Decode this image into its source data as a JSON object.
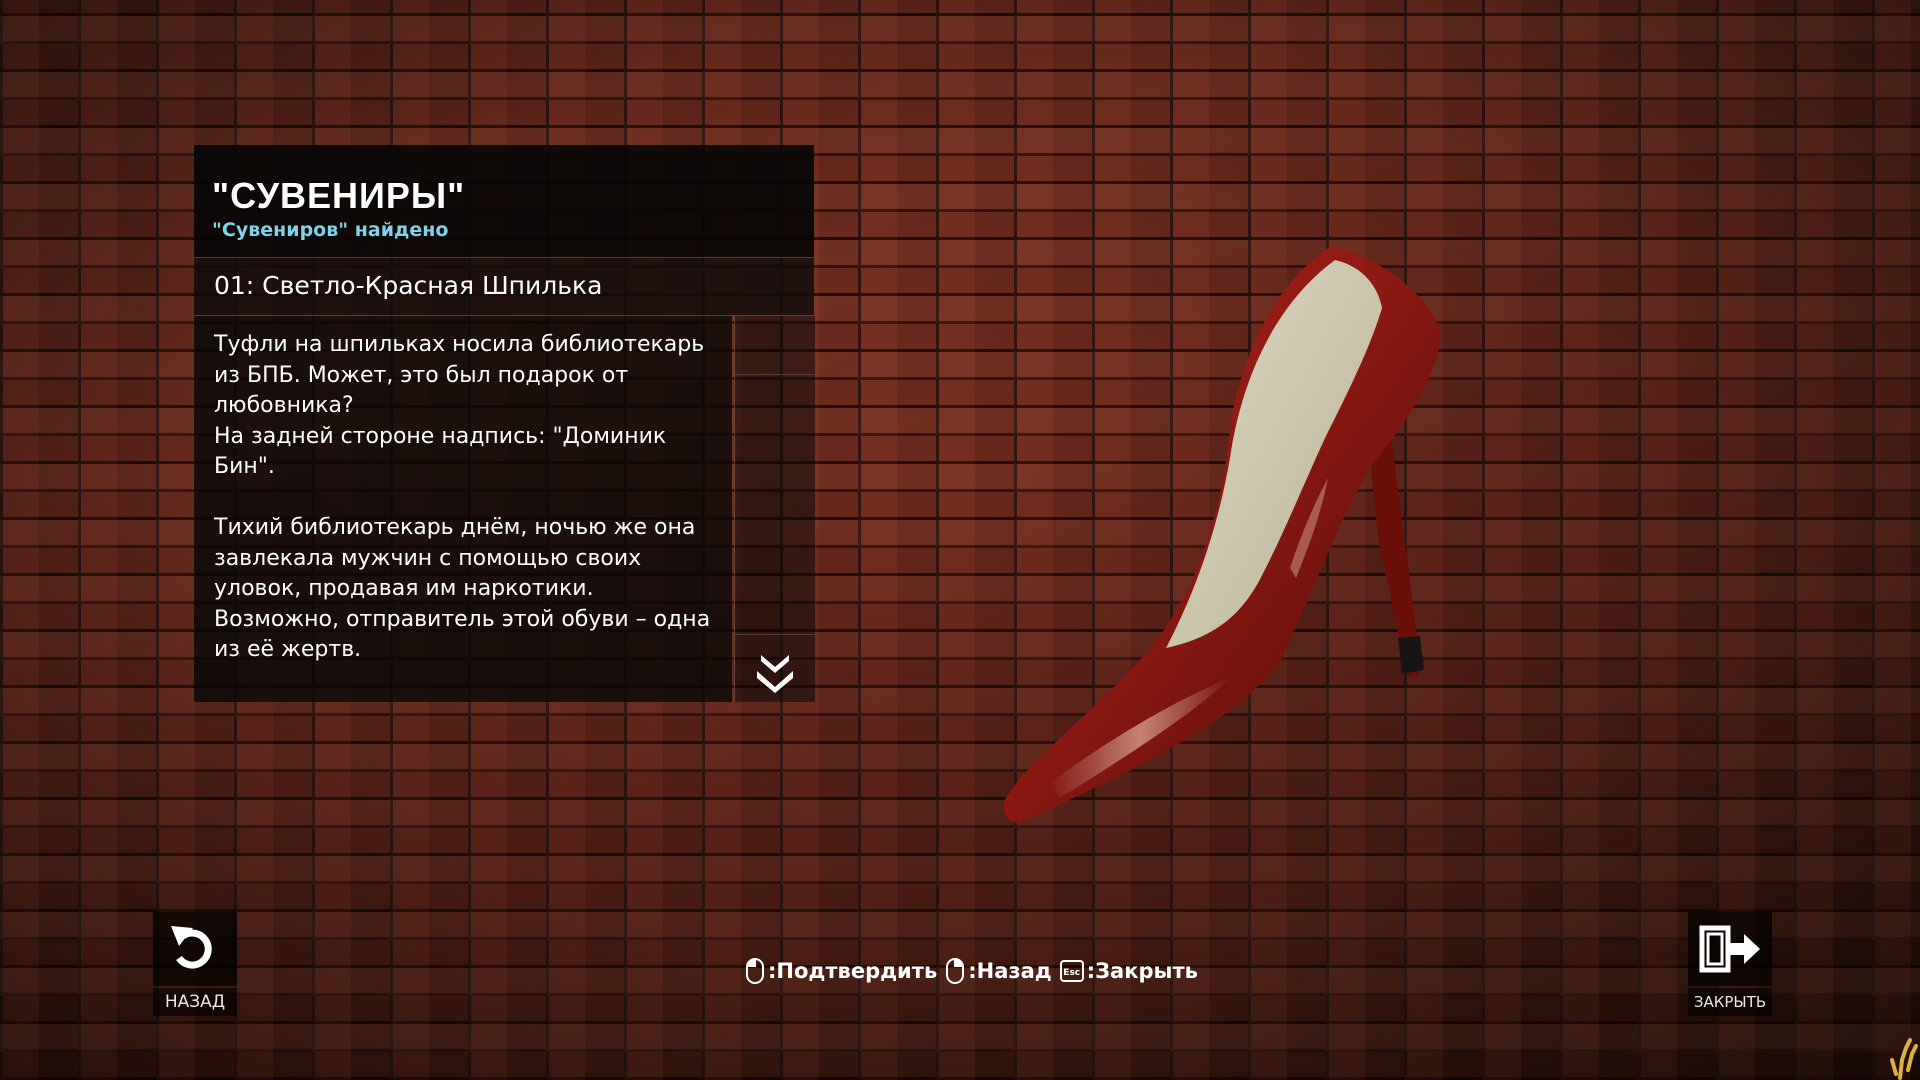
{
  "panel": {
    "title": "\"СУВЕНИРЫ\"",
    "subtitle": "\"Сувениров\" найдено",
    "item_name": "01: Светло-Красная Шпилька",
    "description": "Туфли на шпильках носила библиотекарь из БПБ. Может, это был подарок от любовника?\nНа задней стороне надпись: \"Доминик Бин\".\n\nТихий библиотекарь днём, ночью же она завлекала мужчин с помощью своих уловок, продавая им наркотики. Возможно, отправитель этой обуви – одна из её жертв."
  },
  "buttons": {
    "back_label": "НАЗАД",
    "close_label": "ЗАКРЫТЬ"
  },
  "hints": {
    "confirm": ":Подтвердить",
    "back": ":Назад",
    "esc_key": "Esc",
    "close": ":Закрыть"
  },
  "icons": {
    "back": "undo-arrow-icon",
    "close": "exit-door-icon",
    "scroll": "double-chevron-down-icon",
    "mouse_left": "mouse-left-click-icon",
    "mouse_right": "mouse-right-click-icon"
  },
  "colors": {
    "subtitle": "#7fd2e8",
    "shoe": "#8e1a12",
    "shoe_lining": "#cfcab0"
  }
}
